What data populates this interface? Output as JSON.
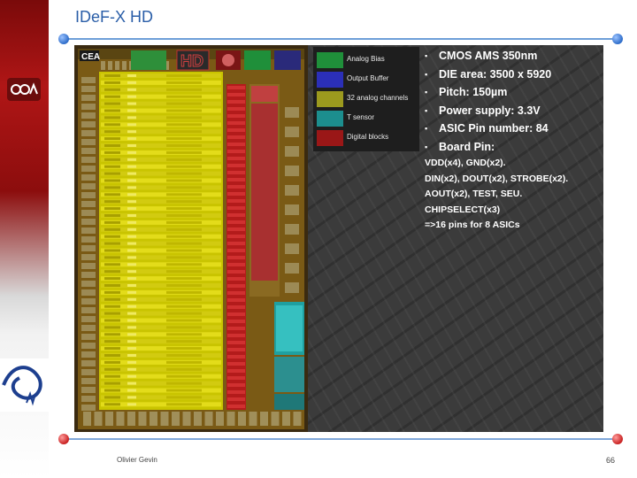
{
  "header": {
    "title": "IDeF-X HD"
  },
  "chip": {
    "logo_text": "CEA",
    "badge_text": "HD"
  },
  "legend": {
    "items": [
      {
        "label": "Analog Bias",
        "color": "#1f8f3a"
      },
      {
        "label": "Output Buffer",
        "color": "#2b2fb8"
      },
      {
        "label": "32 analog channels",
        "color": "#9c9a1e"
      },
      {
        "label": "T sensor",
        "color": "#1c8e8e"
      },
      {
        "label": "Digital blocks",
        "color": "#9a1717"
      }
    ]
  },
  "specs": {
    "bullets": [
      "CMOS AMS 350nm",
      "DIE area: 3500 x 5920",
      "Pitch: 150µm",
      "Power supply: 3.3V",
      "ASIC Pin number: 84",
      "Board Pin:"
    ],
    "details": [
      "VDD(x4), GND(x2).",
      "DIN(x2), DOUT(x2), STROBE(x2).",
      "AOUT(x2), TEST, SEU.",
      "CHIPSELECT(x3)",
      "=>16 pins for 8 ASICs"
    ]
  },
  "footer": {
    "author": "Olivier Gevin",
    "page_number": "66"
  }
}
